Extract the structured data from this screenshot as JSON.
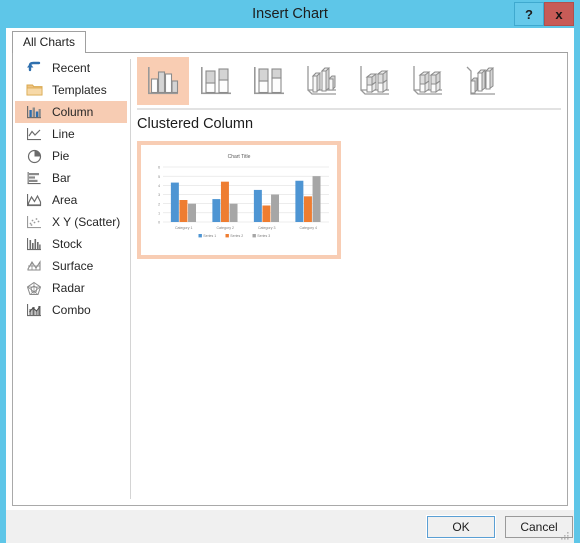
{
  "window": {
    "title": "Insert Chart",
    "help_label": "?",
    "close_label": "x"
  },
  "tabs": [
    {
      "label": "All Charts",
      "selected": true
    }
  ],
  "sidebar": {
    "items": [
      {
        "label": "Recent",
        "icon": "recent-icon",
        "selected": false
      },
      {
        "label": "Templates",
        "icon": "templates-icon",
        "selected": false
      },
      {
        "label": "Column",
        "icon": "column-icon",
        "selected": true
      },
      {
        "label": "Line",
        "icon": "line-icon",
        "selected": false
      },
      {
        "label": "Pie",
        "icon": "pie-icon",
        "selected": false
      },
      {
        "label": "Bar",
        "icon": "bar-icon",
        "selected": false
      },
      {
        "label": "Area",
        "icon": "area-icon",
        "selected": false
      },
      {
        "label": "X Y (Scatter)",
        "icon": "scatter-icon",
        "selected": false
      },
      {
        "label": "Stock",
        "icon": "stock-icon",
        "selected": false
      },
      {
        "label": "Surface",
        "icon": "surface-icon",
        "selected": false
      },
      {
        "label": "Radar",
        "icon": "radar-icon",
        "selected": false
      },
      {
        "label": "Combo",
        "icon": "combo-icon",
        "selected": false
      }
    ]
  },
  "gallery": {
    "items": [
      {
        "name": "clustered-column",
        "selected": true
      },
      {
        "name": "stacked-column",
        "selected": false
      },
      {
        "name": "100-percent-stacked-column",
        "selected": false
      },
      {
        "name": "3d-clustered-column",
        "selected": false
      },
      {
        "name": "3d-stacked-column",
        "selected": false
      },
      {
        "name": "3d-100-percent-stacked-column",
        "selected": false
      },
      {
        "name": "3d-column",
        "selected": false
      }
    ]
  },
  "preview": {
    "heading": "Clustered Column"
  },
  "footer": {
    "ok_label": "OK",
    "cancel_label": "Cancel"
  },
  "colors": {
    "window_frame": "#5ec6e8",
    "highlight": "#f7ccb3",
    "series1": "#4e95d3",
    "series2": "#ee7d31",
    "series3": "#a6a6a6",
    "close_button": "#c75b57"
  },
  "chart_data": {
    "type": "bar",
    "title": "Chart Title",
    "categories": [
      "Category 1",
      "Category 2",
      "Category 3",
      "Category 4"
    ],
    "series": [
      {
        "name": "Series 1",
        "color": "#4e95d3",
        "values": [
          4.3,
          2.5,
          3.5,
          4.5
        ]
      },
      {
        "name": "Series 2",
        "color": "#ee7d31",
        "values": [
          2.4,
          4.4,
          1.8,
          2.8
        ]
      },
      {
        "name": "Series 3",
        "color": "#a6a6a6",
        "values": [
          2.0,
          2.0,
          3.0,
          5.0
        ]
      }
    ],
    "ytick_labels": [
      "0",
      "1",
      "2",
      "3",
      "4",
      "5",
      "6"
    ],
    "ylim": [
      0,
      6
    ],
    "xlabel": "",
    "ylabel": "",
    "grid": true,
    "legend_position": "bottom"
  }
}
